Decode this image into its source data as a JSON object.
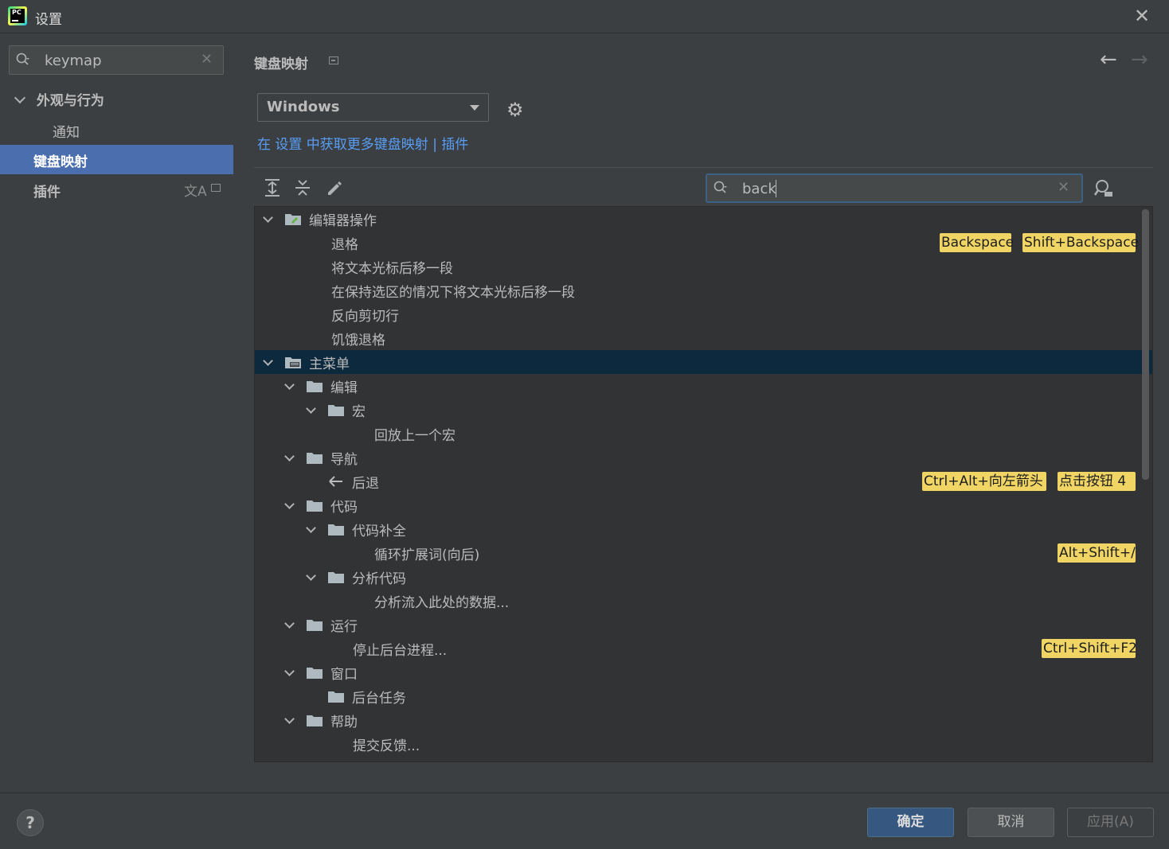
{
  "window": {
    "title": "设置"
  },
  "sidebar": {
    "search_value": "keymap",
    "items": [
      {
        "label": "外观与行为"
      },
      {
        "label": "通知"
      },
      {
        "label": "键盘映射"
      },
      {
        "label": "插件"
      }
    ]
  },
  "main": {
    "heading": "键盘映射",
    "keymap_selected": "Windows",
    "more_link_prefix": "在 设置 中获取更多键盘映射 | 插件",
    "filter_value": "back"
  },
  "tree": [
    {
      "label": "编辑器操作",
      "level": 0,
      "expand": true,
      "icon": "editor-actions-icon"
    },
    {
      "label": "退格",
      "level": 1,
      "shortcuts": [
        "Backspace",
        "Shift+Backspace"
      ]
    },
    {
      "label": "将文本光标后移一段",
      "level": 1
    },
    {
      "label": "在保持选区的情况下将文本光标后移一段",
      "level": 1
    },
    {
      "label": "反向剪切行",
      "level": 1
    },
    {
      "label": "饥饿退格",
      "level": 1
    },
    {
      "label": "主菜单",
      "level": 0,
      "expand": true,
      "icon": "main-menu-icon",
      "selected": true
    },
    {
      "label": "编辑",
      "level": 1,
      "expand": true,
      "icon": "folder-icon"
    },
    {
      "label": "宏",
      "level": 2,
      "expand": true,
      "icon": "folder-icon"
    },
    {
      "label": "回放上一个宏",
      "level": 3
    },
    {
      "label": "导航",
      "level": 1,
      "expand": true,
      "icon": "folder-icon"
    },
    {
      "label": "后退",
      "level": 2,
      "icon": "back-arrow-icon",
      "shortcuts": [
        "Ctrl+Alt+向左箭头",
        "点击按钮 4"
      ]
    },
    {
      "label": "代码",
      "level": 1,
      "expand": true,
      "icon": "folder-icon"
    },
    {
      "label": "代码补全",
      "level": 2,
      "expand": true,
      "icon": "folder-icon"
    },
    {
      "label": "循环扩展词(向后)",
      "level": 3,
      "shortcuts": [
        "Alt+Shift+/"
      ]
    },
    {
      "label": "分析代码",
      "level": 2,
      "expand": true,
      "icon": "folder-icon"
    },
    {
      "label": "分析流入此处的数据...",
      "level": 3
    },
    {
      "label": "运行",
      "level": 1,
      "expand": true,
      "icon": "folder-icon"
    },
    {
      "label": "停止后台进程...",
      "level": 2,
      "shortcuts": [
        "Ctrl+Shift+F2"
      ]
    },
    {
      "label": "窗口",
      "level": 1,
      "expand": true,
      "icon": "folder-icon"
    },
    {
      "label": "后台任务",
      "level": 2,
      "icon": "folder-icon"
    },
    {
      "label": "帮助",
      "level": 1,
      "expand": true,
      "icon": "folder-icon"
    },
    {
      "label": "提交反馈...",
      "level": 2
    }
  ],
  "footer": {
    "help": "?",
    "ok": "确定",
    "cancel": "取消",
    "apply": "应用(A)"
  },
  "colors": {
    "selection": "#4b6eaf",
    "tree_selection": "#0d293e",
    "shortcut_highlight": "#f0d564",
    "link": "#589df6"
  }
}
